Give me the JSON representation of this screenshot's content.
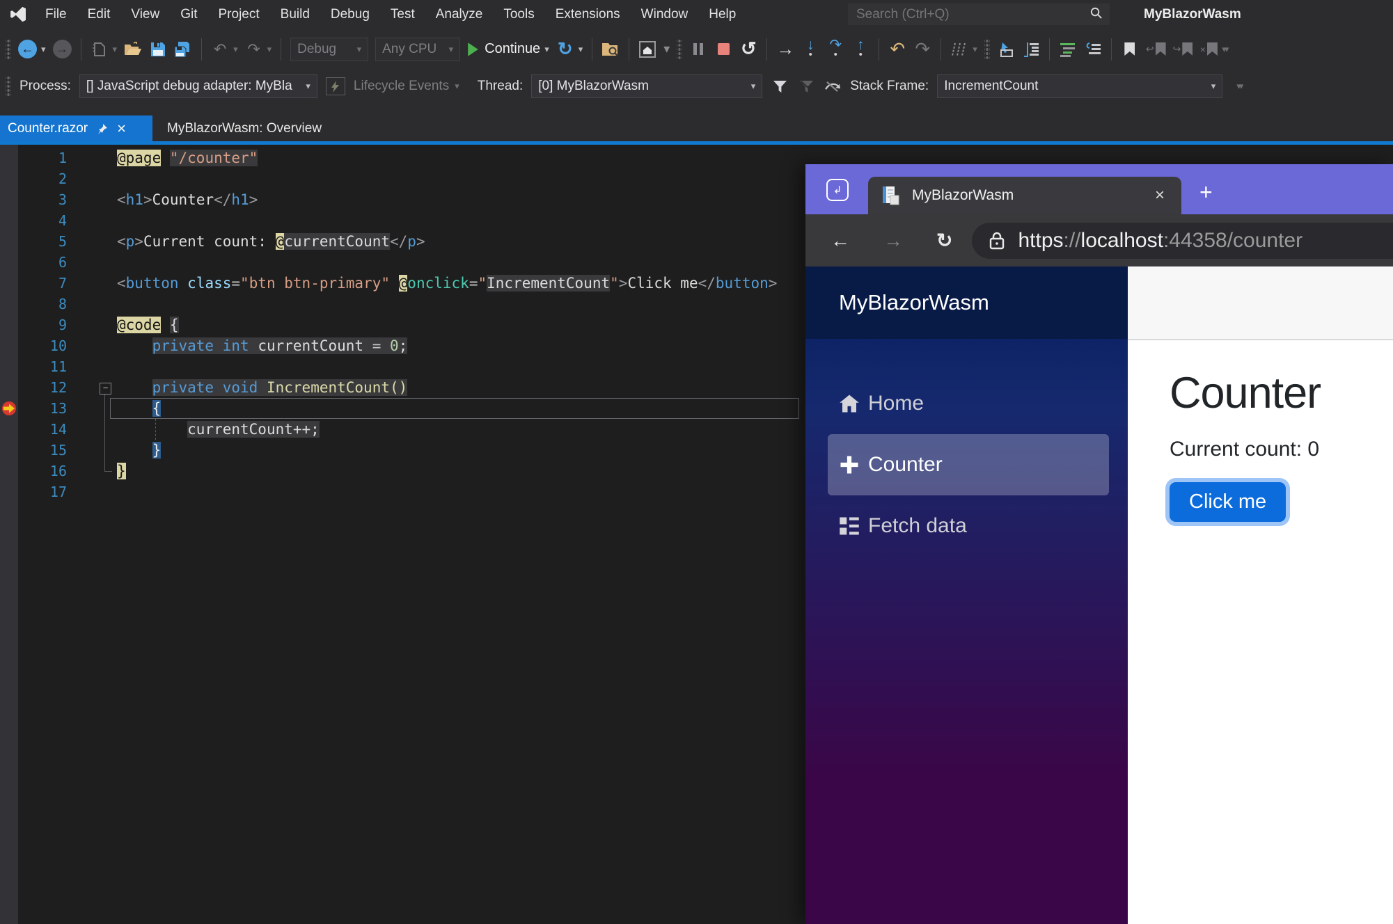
{
  "window": {
    "title": "MyBlazorWasm"
  },
  "menu": {
    "items": [
      "File",
      "Edit",
      "View",
      "Git",
      "Project",
      "Build",
      "Debug",
      "Test",
      "Analyze",
      "Tools",
      "Extensions",
      "Window",
      "Help"
    ]
  },
  "search": {
    "placeholder": "Search (Ctrl+Q)"
  },
  "toolbar": {
    "config": "Debug",
    "platform": "Any CPU",
    "continue_label": "Continue"
  },
  "debugbar": {
    "process_label": "Process:",
    "process_value": "[] JavaScript debug adapter: MyBla",
    "lifecycle_label": "Lifecycle Events",
    "thread_label": "Thread:",
    "thread_value": "[0] MyBlazorWasm",
    "stack_label": "Stack Frame:",
    "stack_value": "IncrementCount"
  },
  "tabs": {
    "active": "Counter.razor",
    "inactive": "MyBlazorWasm: Overview"
  },
  "editor": {
    "collapse_glyph": "−"
  },
  "code": {
    "lines": [
      {
        "n": "1",
        "seg": [
          [
            "@page",
            "razor"
          ],
          [
            " ",
            ""
          ],
          [
            "\"/counter\"",
            "str cs"
          ]
        ]
      },
      {
        "n": "2",
        "seg": []
      },
      {
        "n": "3",
        "seg": [
          [
            "<",
            "p"
          ],
          [
            "h1",
            "tag"
          ],
          [
            ">",
            "p"
          ],
          [
            "Counter",
            "txt"
          ],
          [
            "</",
            "p"
          ],
          [
            "h1",
            "tag"
          ],
          [
            ">",
            "p"
          ]
        ]
      },
      {
        "n": "4",
        "seg": []
      },
      {
        "n": "5",
        "seg": [
          [
            "<",
            "p"
          ],
          [
            "p",
            "tag"
          ],
          [
            ">",
            "p"
          ],
          [
            "Current count: ",
            "txt"
          ],
          [
            "@",
            "razor"
          ],
          [
            "currentCount",
            "txt cs"
          ],
          [
            "</",
            "p"
          ],
          [
            "p",
            "tag"
          ],
          [
            ">",
            "p"
          ]
        ]
      },
      {
        "n": "6",
        "seg": []
      },
      {
        "n": "7",
        "seg": [
          [
            "<",
            "p"
          ],
          [
            "button",
            "tag"
          ],
          [
            " ",
            ""
          ],
          [
            "class",
            "attr"
          ],
          [
            "=",
            "op"
          ],
          [
            "\"btn btn-primary\"",
            "str"
          ],
          [
            " ",
            ""
          ],
          [
            "@",
            "razor"
          ],
          [
            "onclick",
            "dir"
          ],
          [
            "=",
            "op"
          ],
          [
            "\"",
            "str"
          ],
          [
            "IncrementCount",
            "txt cs"
          ],
          [
            "\"",
            "str"
          ],
          [
            ">",
            "p"
          ],
          [
            "Click me",
            "txt"
          ],
          [
            "</",
            "p"
          ],
          [
            "button",
            "tag"
          ],
          [
            ">",
            "p"
          ]
        ]
      },
      {
        "n": "8",
        "seg": []
      },
      {
        "n": "9",
        "seg": [
          [
            "@code",
            "razor"
          ],
          [
            " ",
            ""
          ],
          [
            "{",
            "txt cs"
          ]
        ]
      },
      {
        "n": "10",
        "seg": [
          [
            "    ",
            ""
          ],
          [
            "private",
            "kw cs"
          ],
          [
            " ",
            "cs"
          ],
          [
            "int",
            "kw cs"
          ],
          [
            " ",
            "cs"
          ],
          [
            "currentCount",
            "txt cs"
          ],
          [
            " ",
            "cs"
          ],
          [
            "=",
            "op cs"
          ],
          [
            " ",
            "cs"
          ],
          [
            "0",
            "num cs"
          ],
          [
            ";",
            "txt cs"
          ]
        ]
      },
      {
        "n": "11",
        "seg": []
      },
      {
        "n": "12",
        "seg": [
          [
            "    ",
            ""
          ],
          [
            "private",
            "kw cs"
          ],
          [
            " ",
            "cs"
          ],
          [
            "void",
            "kw cs"
          ],
          [
            " ",
            "cs"
          ],
          [
            "IncrementCount()",
            "m cs"
          ]
        ]
      },
      {
        "n": "13",
        "seg": [
          [
            "    ",
            ""
          ],
          [
            "{",
            "brace"
          ]
        ]
      },
      {
        "n": "14",
        "seg": [
          [
            "        ",
            ""
          ],
          [
            "currentCount++;",
            "txt cs"
          ]
        ]
      },
      {
        "n": "15",
        "seg": [
          [
            "    ",
            ""
          ],
          [
            "}",
            "brace"
          ]
        ]
      },
      {
        "n": "16",
        "seg": [
          [
            "}",
            "khaki"
          ]
        ]
      },
      {
        "n": "17",
        "seg": []
      }
    ]
  },
  "browser": {
    "tab_title": "MyBlazorWasm",
    "url": {
      "scheme": "https",
      "sep": "://",
      "host": "localhost",
      "rest": ":44358/counter"
    }
  },
  "app": {
    "brand": "MyBlazorWasm",
    "nav": [
      {
        "label": "Home",
        "icon": "home-icon"
      },
      {
        "label": "Counter",
        "icon": "plus-icon"
      },
      {
        "label": "Fetch data",
        "icon": "list-icon"
      }
    ],
    "heading": "Counter",
    "count_text": "Current count: 0",
    "button_label": "Click me"
  },
  "colors": {
    "active_tab_blue": "#1574CF",
    "tab_underline_blue": "#1179CF",
    "continue_green": "#4CB04F",
    "stop_red": "#E8837C",
    "browser_purple": "#6B68D7",
    "button_blue": "#0C6CDC",
    "focus_ring": "#9EC5F6",
    "sidebar_gradient_top": "#0E2366",
    "sidebar_gradient_bottom": "#3A0647",
    "razor_highlight": "#DCD6A4",
    "code_block_highlight": "#3A3A3D"
  }
}
